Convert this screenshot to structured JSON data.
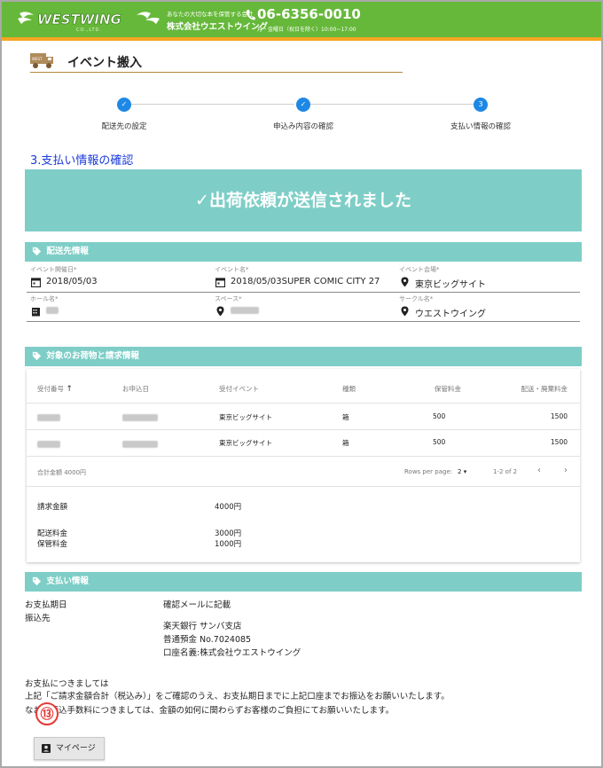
{
  "header": {
    "logo_text": "WESTWING",
    "logo_sub": "CO.,LTD.",
    "tagline": "あなたの大切な本を保管する会社",
    "company_name": "株式会社ウエストウイング",
    "phone": "06-6356-0010",
    "hours": "月・金曜日（祝日を除く）10:00~17:00",
    "colors": {
      "green": "#66b83a",
      "orange": "#f5a623"
    }
  },
  "page": {
    "title": "イベント搬入",
    "icon": "truck-icon"
  },
  "stepper": {
    "steps": [
      {
        "label": "配送先の設定",
        "state": "done",
        "mark": "✓"
      },
      {
        "label": "申込み内容の確認",
        "state": "done",
        "mark": "✓"
      },
      {
        "label": "支払い情報の確認",
        "state": "active",
        "mark": "3"
      }
    ]
  },
  "section_heading": "3.支払い情報の確認",
  "success_message": "✓出荷依頼が送信されました",
  "delivery": {
    "bar_title": "配送先情報",
    "fields": {
      "event_date": {
        "label": "イベント開催日*",
        "value": "2018/05/03"
      },
      "event_name": {
        "label": "イベント名*",
        "value": "2018/05/03SUPER COMIC CITY 27"
      },
      "venue": {
        "label": "イベント会場*",
        "value": "東京ビッグサイト"
      },
      "hall": {
        "label": "ホール名*"
      },
      "space": {
        "label": "スペース*"
      },
      "circle": {
        "label": "サークル名*",
        "value": "ウエストウイング"
      }
    }
  },
  "orders": {
    "bar_title": "対象のお荷物と請求情報",
    "columns": [
      "受付番号",
      "お申込日",
      "受付イベント",
      "種類",
      "保管料金",
      "配送・廃棄料金"
    ],
    "sort_arrow": "↑",
    "rows": [
      {
        "event": "東京ビッグサイト",
        "type": "箱",
        "storage": "500",
        "shipping": "1500"
      },
      {
        "event": "東京ビッグサイト",
        "type": "箱",
        "storage": "500",
        "shipping": "1500"
      }
    ],
    "total_label": "合計金額 4000円",
    "rows_per_page_label": "Rows per page:",
    "rows_per_page_value": "2",
    "range": "1-2 of 2",
    "summary": {
      "billing_label": "請求金額",
      "billing_value": "4000円",
      "shipping_label": "配送料金",
      "shipping_value": "3000円",
      "storage_label": "保管料金",
      "storage_value": "1000円"
    }
  },
  "payment": {
    "bar_title": "支払い情報",
    "due_label": "お支払期日",
    "due_value": "確認メールに記載",
    "account_label": "振込先",
    "bank": "楽天銀行 サンバ支店",
    "account_no": "普通預金 No.7024085",
    "account_name": "口座名義:株式会社ウエストウイング",
    "note1": "お支払につきましては",
    "note2": "上記「ご請求金額合計（税込み）」をご確認のうえ、お支払期日までに上記口座までお振込をお願いいたします。",
    "note3": "なお、振込手数料につきましては、金額の如何に関わらずお客様のご負担にてお願いいたします。",
    "badge": "⑬"
  },
  "mypage_button": "マイページ"
}
